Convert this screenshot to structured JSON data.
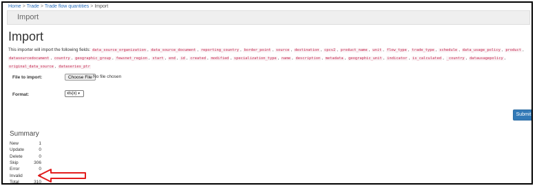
{
  "breadcrumb": {
    "home": "Home",
    "trade": "Trade",
    "section": "Trade flow quantities",
    "current": "Import",
    "sep": ">"
  },
  "title_bar": "Import",
  "page_title": "Import",
  "intro_text": "This importer will import the following fields:",
  "fields": [
    "data_source_organization",
    "data_source_document",
    "reporting_country",
    "border_point",
    "source",
    "destination",
    "cpcv2",
    "product_name",
    "unit",
    "flow_type",
    "trade_type",
    "schedule",
    "data_usage_policy",
    "product",
    "datasourcedocument",
    "country",
    "geographic_group",
    "fewsnet_region",
    "start",
    "end",
    "id",
    "created",
    "modified",
    "specialization_type",
    "name",
    "description",
    "metadata",
    "geographic_unit",
    "indicator",
    "is_calculated",
    "_country",
    "datausagepolicy",
    "original_data_source",
    "dataseries_ptr"
  ],
  "form": {
    "file_label": "File to import:",
    "choose_file": "Choose File",
    "file_status": "No file chosen",
    "format_label": "Format:",
    "format_value": "xls(x)"
  },
  "submit_label": "Submit",
  "summary": {
    "title": "Summary",
    "rows": [
      {
        "label": "New",
        "value": "1"
      },
      {
        "label": "Update",
        "value": "0"
      },
      {
        "label": "Delete",
        "value": "0"
      },
      {
        "label": "Skip",
        "value": "306"
      },
      {
        "label": "Error",
        "value": "0"
      },
      {
        "label": "Invalid",
        "value": "3"
      },
      {
        "label": "Total",
        "value": "310"
      }
    ]
  },
  "colors": {
    "arrow": "#e31b1b",
    "submit": "#337ab7",
    "link": "#2a6ebb"
  }
}
